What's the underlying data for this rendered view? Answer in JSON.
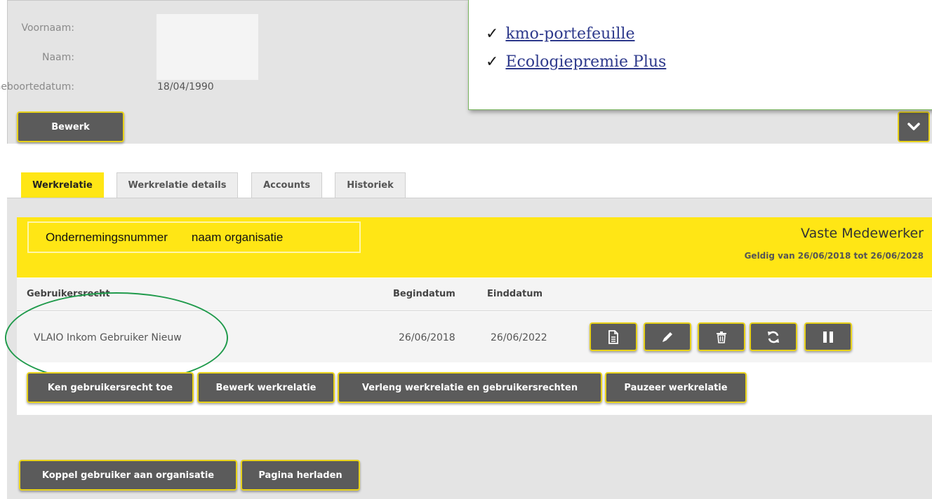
{
  "profile": {
    "fields": [
      {
        "label": "Voornaam:",
        "value": ""
      },
      {
        "label": "Naam:",
        "value": ""
      },
      {
        "label": "Geboortedatum:",
        "value": "18/04/1990"
      }
    ],
    "edit_label": "Bewerk"
  },
  "callout": {
    "items": [
      {
        "check": "✓",
        "link": "kmo-portefeuille"
      },
      {
        "check": "✓",
        "link": "Ecologiepremie Plus"
      }
    ]
  },
  "tabs": [
    {
      "label": "Werkrelatie",
      "active": true
    },
    {
      "label": "Werkrelatie details",
      "active": false
    },
    {
      "label": "Accounts",
      "active": false
    },
    {
      "label": "Historiek",
      "active": false
    }
  ],
  "relation": {
    "org_number": "Ondernemingsnummer",
    "org_name": "naam organisatie",
    "role": "Vaste Medewerker",
    "validity": "Geldig van 26/06/2018 tot 26/06/2028"
  },
  "table": {
    "headers": [
      "Gebruikersrecht",
      "Begindatum",
      "Einddatum"
    ],
    "rows": [
      {
        "right": "VLAIO Inkom Gebruiker Nieuw",
        "start": "26/06/2018",
        "end": "26/06/2022"
      }
    ]
  },
  "actions": {
    "assign": "Ken gebruikersrecht toe",
    "edit_relation": "Bewerk werkrelatie",
    "extend": "Verleng werkrelatie en gebruikersrechten",
    "pause": "Pauzeer werkrelatie"
  },
  "footer": {
    "link_user": "Koppel gebruiker aan organisatie",
    "reload": "Pagina herladen"
  },
  "colors": {
    "accent_yellow": "#ffe615",
    "button_grey": "#5b5b5b",
    "highlight_green": "#1f9a4b",
    "link_blue": "#2e3a8c"
  },
  "icons": [
    "document-icon",
    "pencil-icon",
    "trash-icon",
    "refresh-icon",
    "pause-icon",
    "chevron-down-icon"
  ]
}
